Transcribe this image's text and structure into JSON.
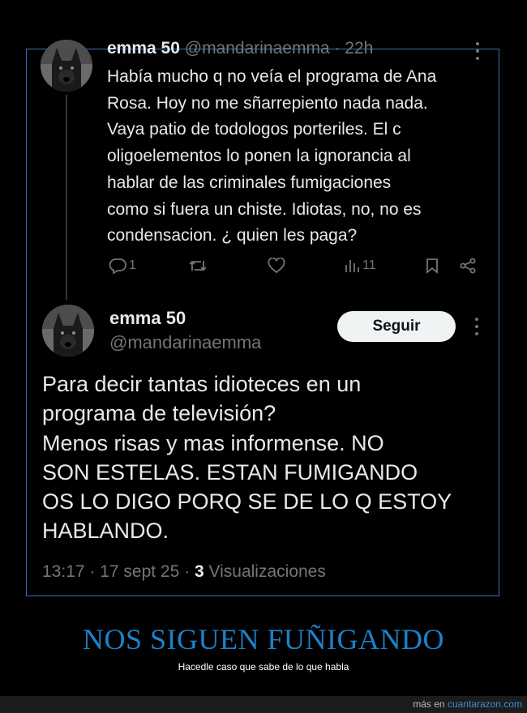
{
  "tweet1": {
    "display_name": "emma 50",
    "handle_time": "@mandarinaemma · 22h",
    "text_lines": [
      "Había mucho q no veía el programa de Ana",
      "Rosa. Hoy no me sñarrepiento nada nada.",
      "Vaya patio de todologos porteriles. El c",
      "oligoelementos lo ponen la ignorancia al",
      "hablar de las criminales fumigaciones",
      "como si fuera un chiste. Idiotas, no, no es",
      "condensacion. ¿ quien les paga?"
    ],
    "actions": {
      "reply_count": "1",
      "retweet_count": "",
      "like_count": "",
      "views_count": "11"
    }
  },
  "tweet2": {
    "display_name": "emma 50",
    "handle": "@mandarinaemma",
    "follow_label": "Seguir",
    "text_lines": [
      "Para decir tantas idioteces en un",
      "programa de televisión?",
      "Menos risas y mas informense. NO",
      "SON ESTELAS. ESTAN FUMIGANDO",
      "OS LO DIGO PORQ SE DE LO Q ESTOY",
      "HABLANDO."
    ],
    "time_date": "13:17 · 17 sept 25 · ",
    "views_count": "3",
    "views_label": " Visualizaciones"
  },
  "caption": {
    "title": "NOS SIGUEN FUÑIGANDO",
    "subtitle": "Hacedle caso que sabe de lo que habla"
  },
  "footer": {
    "prefix": "más en ",
    "site": "cuantarazon.com"
  },
  "colors": {
    "background": "#000000",
    "frame_border": "#3b6fb8",
    "caption_blue": "#1b82c8",
    "muted_text": "#71767b",
    "link_blue": "#3a91d6"
  }
}
